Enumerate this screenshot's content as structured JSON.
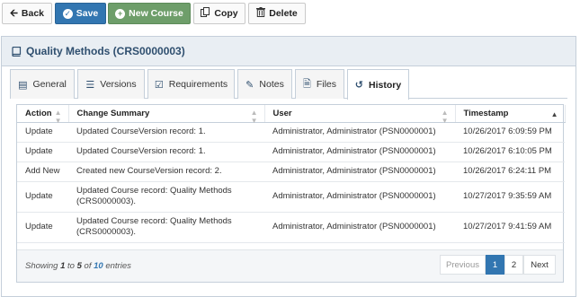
{
  "toolbar": {
    "back": "Back",
    "save": "Save",
    "new_course": "New Course",
    "copy": "Copy",
    "delete": "Delete"
  },
  "panel": {
    "title": "Quality Methods (CRS0000003)"
  },
  "tabs": [
    {
      "label": "General",
      "icon": "list-alt-icon"
    },
    {
      "label": "Versions",
      "icon": "list-icon"
    },
    {
      "label": "Requirements",
      "icon": "check-square-icon"
    },
    {
      "label": "Notes",
      "icon": "pencil-icon"
    },
    {
      "label": "Files",
      "icon": "file-icon"
    },
    {
      "label": "History",
      "icon": "history-icon",
      "active": true
    }
  ],
  "table": {
    "columns": [
      "Action",
      "Change Summary",
      "User",
      "Timestamp"
    ],
    "sorted_column": "Timestamp",
    "rows": [
      {
        "action": "Update",
        "summary": "Updated CourseVersion record: 1.",
        "user": "Administrator, Administrator (PSN0000001)",
        "timestamp": "10/26/2017 6:09:59 PM"
      },
      {
        "action": "Update",
        "summary": "Updated CourseVersion record: 1.",
        "user": "Administrator, Administrator (PSN0000001)",
        "timestamp": "10/26/2017 6:10:05 PM"
      },
      {
        "action": "Add New",
        "summary": "Created new CourseVersion record: 2.",
        "user": "Administrator, Administrator (PSN0000001)",
        "timestamp": "10/26/2017 6:24:11 PM"
      },
      {
        "action": "Update",
        "summary_line1": "Updated Course record: Quality Methods",
        "summary_line2": "(CRS0000003).",
        "user": "Administrator, Administrator (PSN0000001)",
        "timestamp": "10/27/2017 9:35:59 AM"
      },
      {
        "action": "Update",
        "summary_line1": "Updated Course record: Quality Methods",
        "summary_line2": "(CRS0000003).",
        "user": "Administrator, Administrator (PSN0000001)",
        "timestamp": "10/27/2017 9:41:59 AM"
      }
    ]
  },
  "footer": {
    "showing": "Showing",
    "from": "1",
    "to_word": "to",
    "to": "5",
    "of_word": "of",
    "total": "10",
    "entries": "entries",
    "prev": "Previous",
    "page1": "1",
    "page2": "2",
    "next": "Next"
  },
  "colors": {
    "primary": "#3276b1",
    "success": "#6e9e6a",
    "panel_header": "#e9eef3",
    "title": "#2f4f6f"
  }
}
